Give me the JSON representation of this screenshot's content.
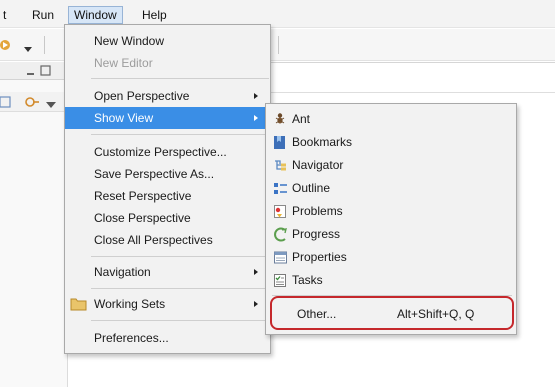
{
  "menubar": {
    "items": [
      {
        "label": "t"
      },
      {
        "label": "Run"
      },
      {
        "label": "Window"
      },
      {
        "label": "Help"
      }
    ]
  },
  "window_menu": {
    "items": [
      {
        "label": "New Window",
        "enabled": true
      },
      {
        "label": "New Editor",
        "enabled": false
      },
      {
        "label": "Open Perspective",
        "submenu": true
      },
      {
        "label": "Show View",
        "submenu": true,
        "highlighted": true
      },
      {
        "label": "Customize Perspective..."
      },
      {
        "label": "Save Perspective As..."
      },
      {
        "label": "Reset Perspective"
      },
      {
        "label": "Close Perspective"
      },
      {
        "label": "Close All Perspectives"
      },
      {
        "label": "Navigation",
        "submenu": true
      },
      {
        "label": "Working Sets",
        "submenu": true
      },
      {
        "label": "Preferences..."
      }
    ]
  },
  "show_view_menu": {
    "items": [
      {
        "label": "Ant",
        "icon": "ant-icon"
      },
      {
        "label": "Bookmarks",
        "icon": "bookmarks-icon"
      },
      {
        "label": "Navigator",
        "icon": "navigator-icon"
      },
      {
        "label": "Outline",
        "icon": "outline-icon"
      },
      {
        "label": "Problems",
        "icon": "problems-icon"
      },
      {
        "label": "Progress",
        "icon": "progress-icon"
      },
      {
        "label": "Properties",
        "icon": "properties-icon"
      },
      {
        "label": "Tasks",
        "icon": "tasks-icon"
      }
    ],
    "other": {
      "label": "Other...",
      "accelerator": "Alt+Shift+Q, Q"
    }
  },
  "colors": {
    "highlight": "#3a8ee6",
    "callout": "#c5282c",
    "menu_bg": "#f2f2f2"
  }
}
